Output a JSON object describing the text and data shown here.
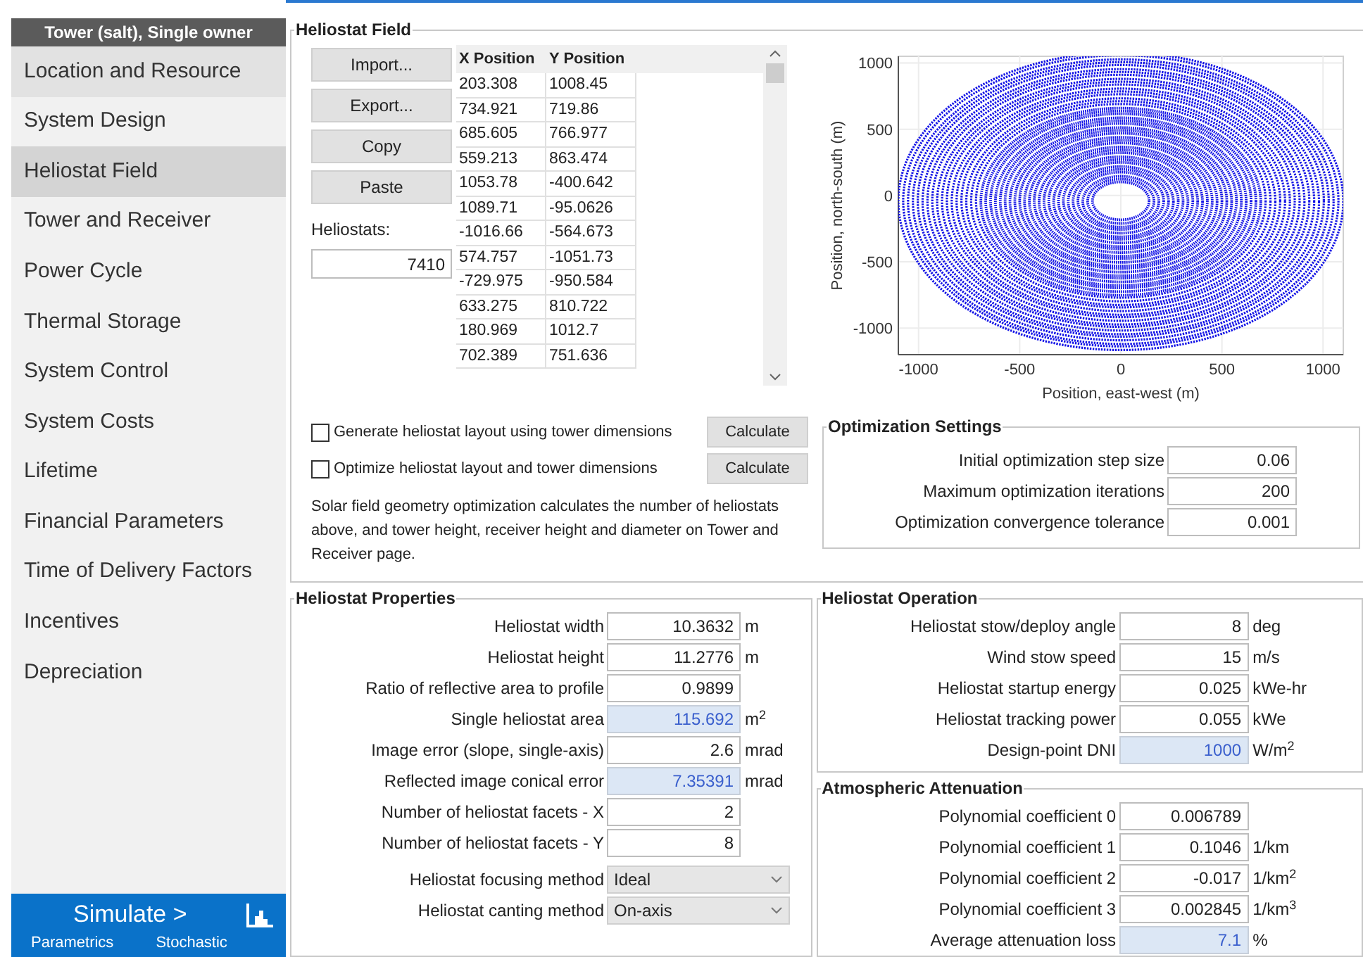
{
  "sidebar": {
    "title": "Tower (salt), Single owner",
    "items": [
      {
        "label": "Location and Resource",
        "selected": false,
        "hovered": true
      },
      {
        "label": "System Design",
        "selected": false,
        "hovered": false
      },
      {
        "label": "Heliostat Field",
        "selected": true,
        "hovered": false
      },
      {
        "label": "Tower and Receiver",
        "selected": false,
        "hovered": false
      },
      {
        "label": "Power Cycle",
        "selected": false,
        "hovered": false
      },
      {
        "label": "Thermal Storage",
        "selected": false,
        "hovered": false
      },
      {
        "label": "System Control",
        "selected": false,
        "hovered": false
      },
      {
        "label": "System Costs",
        "selected": false,
        "hovered": false
      },
      {
        "label": "Lifetime",
        "selected": false,
        "hovered": false
      },
      {
        "label": "Financial Parameters",
        "selected": false,
        "hovered": false
      },
      {
        "label": "Time of Delivery Factors",
        "selected": false,
        "hovered": false
      },
      {
        "label": "Incentives",
        "selected": false,
        "hovered": false
      },
      {
        "label": "Depreciation",
        "selected": false,
        "hovered": false
      }
    ],
    "simulate": "Simulate >",
    "links": [
      "Parametrics",
      "Stochastic"
    ]
  },
  "heliostat_field": {
    "title": "Heliostat Field",
    "buttons": [
      "Import...",
      "Export...",
      "Copy",
      "Paste"
    ],
    "count_label": "Heliostats:",
    "count": "7410",
    "table": {
      "columns": [
        "X Position",
        "Y Position"
      ],
      "rows": [
        [
          "203.308",
          "1008.45"
        ],
        [
          "734.921",
          "719.86"
        ],
        [
          "685.605",
          "766.977"
        ],
        [
          "559.213",
          "863.474"
        ],
        [
          "1053.78",
          "-400.642"
        ],
        [
          "1089.71",
          "-95.0626"
        ],
        [
          "-1016.66",
          "-564.673"
        ],
        [
          "574.757",
          "-1051.73"
        ],
        [
          "-729.975",
          "-950.584"
        ],
        [
          "633.275",
          "810.722"
        ],
        [
          "180.969",
          "1012.7"
        ],
        [
          "702.389",
          "751.636"
        ]
      ]
    },
    "plot": {
      "xlabel": "Position, east-west (m)",
      "ylabel": "Position, north-south (m)",
      "xticks": [
        "-1000",
        "-500",
        "0",
        "500",
        "1000"
      ],
      "yticks": [
        "1000",
        "500",
        "0",
        "-500",
        "-1000"
      ]
    },
    "options": [
      {
        "label": "Generate heliostat layout using tower dimensions",
        "checked": false,
        "button": "Calculate"
      },
      {
        "label": "Optimize heliostat layout and tower dimensions",
        "checked": false,
        "button": "Calculate"
      }
    ],
    "note": "Solar field geometry optimization calculates the number of heliostats above, and tower height, receiver height and diameter on Tower and Receiver page."
  },
  "optimization_settings": {
    "title": "Optimization Settings",
    "fields": [
      {
        "label": "Initial optimization step size",
        "value": "0.06",
        "kind": "input"
      },
      {
        "label": "Maximum optimization iterations",
        "value": "200",
        "kind": "input"
      },
      {
        "label": "Optimization convergence tolerance",
        "value": "0.001",
        "kind": "input"
      }
    ]
  },
  "heliostat_properties": {
    "title": "Heliostat Properties",
    "fields": [
      {
        "label": "Heliostat width",
        "value": "10.3632",
        "unit": "m",
        "kind": "input"
      },
      {
        "label": "Heliostat height",
        "value": "11.2776",
        "unit": "m",
        "kind": "input"
      },
      {
        "label": "Ratio of reflective area to profile",
        "value": "0.9899",
        "kind": "input"
      },
      {
        "label": "Single heliostat area",
        "value": "115.692",
        "unit": "m$^{2}$",
        "kind": "computed"
      },
      {
        "label": "Image error (slope, single-axis)",
        "value": "2.6",
        "unit": "mrad",
        "kind": "input"
      },
      {
        "label": "Reflected image conical error",
        "value": "7.35391",
        "unit": "mrad",
        "kind": "computed"
      },
      {
        "label": "Number of heliostat facets - X",
        "value": "2",
        "kind": "input"
      },
      {
        "label": "Number of heliostat facets - Y",
        "value": "8",
        "kind": "input"
      },
      {
        "label": "Heliostat focusing method",
        "value": "Ideal",
        "kind": "select"
      },
      {
        "label": "Heliostat canting method",
        "value": "On-axis",
        "kind": "select"
      }
    ]
  },
  "heliostat_operation": {
    "title": "Heliostat Operation",
    "fields": [
      {
        "label": "Heliostat stow/deploy angle",
        "value": "8",
        "unit": "deg",
        "kind": "input"
      },
      {
        "label": "Wind stow speed",
        "value": "15",
        "unit": "m/s",
        "kind": "input"
      },
      {
        "label": "Heliostat startup energy",
        "value": "0.025",
        "unit": "kWe-hr",
        "kind": "input"
      },
      {
        "label": "Heliostat tracking power",
        "value": "0.055",
        "unit": "kWe",
        "kind": "input"
      },
      {
        "label": "Design-point DNI",
        "value": "1000",
        "unit": "W/m$^{2}$",
        "kind": "computed"
      }
    ]
  },
  "atmospheric_attenuation": {
    "title": "Atmospheric Attenuation",
    "fields": [
      {
        "label": "Polynomial coefficient 0",
        "value": "0.006789",
        "kind": "input"
      },
      {
        "label": "Polynomial coefficient 1",
        "value": "0.1046",
        "unit": "1/km",
        "kind": "input"
      },
      {
        "label": "Polynomial coefficient 2",
        "value": "-0.017",
        "unit": "1/km$^{2}$",
        "kind": "input"
      },
      {
        "label": "Polynomial coefficient 3",
        "value": "0.002845",
        "unit": "1/km$^{3}$",
        "kind": "input"
      },
      {
        "label": "Average attenuation loss",
        "value": "7.1",
        "unit": "%",
        "kind": "computed"
      }
    ]
  }
}
